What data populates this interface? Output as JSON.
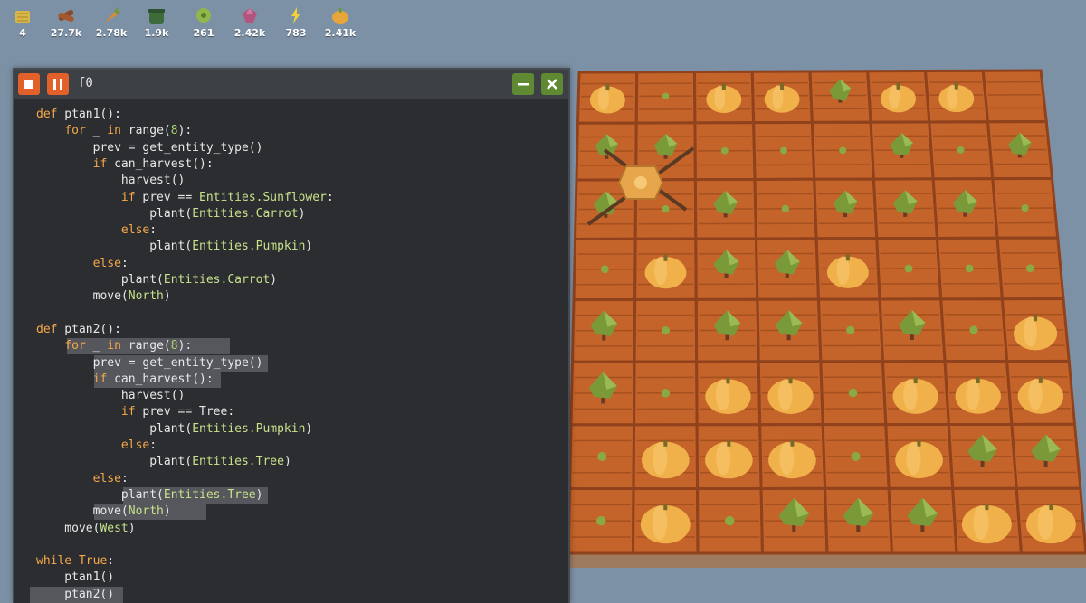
{
  "resources": [
    {
      "icon": "hay-icon",
      "value": "4",
      "color": "#d8b64a"
    },
    {
      "icon": "wood-icon",
      "value": "27.7k",
      "color": "#8a4a2a"
    },
    {
      "icon": "carrot-icon",
      "value": "2.78k",
      "color": "#e08a2c"
    },
    {
      "icon": "cactus-icon",
      "value": "1.9k",
      "color": "#3d6b3a"
    },
    {
      "icon": "sunflower-icon",
      "value": "261",
      "color": "#8fb84a"
    },
    {
      "icon": "gem-icon",
      "value": "2.42k",
      "color": "#b4547e"
    },
    {
      "icon": "power-icon",
      "value": "783",
      "color": "#f2d23a"
    },
    {
      "icon": "pumpkin-icon",
      "value": "2.41k",
      "color": "#e8a63a"
    }
  ],
  "window": {
    "title": "f0",
    "buttons": [
      "stop-button",
      "pause-button",
      "minimize-button",
      "close-button"
    ]
  },
  "code_lines": [
    "def ptan1():",
    "    for _ in range(8):",
    "        prev = get_entity_type()",
    "        if can_harvest():",
    "            harvest()",
    "            if prev == Entities.Sunflower:",
    "                plant(Entities.Carrot)",
    "            else:",
    "                plant(Entities.Pumpkin)",
    "        else:",
    "            plant(Entities.Carrot)",
    "        move(North)",
    "",
    "def ptan2():",
    "    for _ in range(8):",
    "        prev = get_entity_type()",
    "        if can_harvest():",
    "            harvest()",
    "            if prev == Tree:",
    "                plant(Entities.Pumpkin)",
    "            else:",
    "                plant(Entities.Tree)",
    "        else:",
    "            plant(Entities.Tree)",
    "        move(North)",
    "    move(West)",
    "",
    "while True:",
    "    ptan1()",
    "    ptan2()"
  ],
  "colors": {
    "keyword": "#f5a84a",
    "number": "#a7d36a",
    "entity": "#c7e28b",
    "soil": "#c4632a",
    "pumpkin": "#f0b04a",
    "tree": "#7a9a3a",
    "sky": "#7d91a6"
  }
}
